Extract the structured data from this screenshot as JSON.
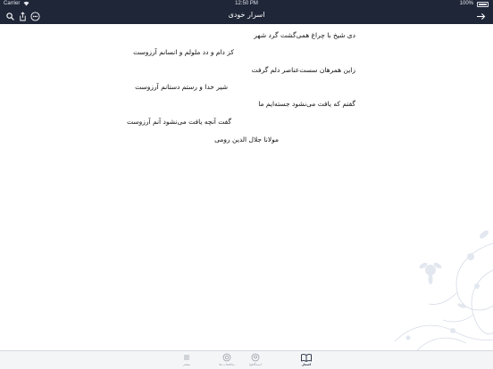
{
  "status_bar": {
    "carrier": "Carrier",
    "time": "12:50 PM",
    "battery": "100%"
  },
  "nav": {
    "title": "اسرار خودی",
    "left_icons": [
      "search-icon",
      "share-icon",
      "settings-icon"
    ],
    "right_icon": "forward-arrow-icon"
  },
  "poem": {
    "lines": [
      "دی شیخ با چراغ همی‌گشت گرد شهر",
      "کز دام و دد ملولم و انسانم آرزوست",
      "زاین همرهان سست‌عناصر دلم گرفت",
      "شیر خدا و رستم دستانم آرزوست",
      "گفتم که یافت می‌نشود جسته‌ایم ما",
      "گفت آنچه یافت می‌نشود آنم آرزوست"
    ],
    "author": "مولانا جلال الدین رومی"
  },
  "tabs": [
    {
      "label": "اشعار",
      "icon": "book-icon",
      "active": true
    },
    {
      "label": "ایستگاهها",
      "icon": "location-icon",
      "active": false
    },
    {
      "label": "مناقشات ها",
      "icon": "circle-icon",
      "active": false
    },
    {
      "label": "بیشتر",
      "icon": "more-icon",
      "active": false
    }
  ],
  "colors": {
    "header": "#1f2638",
    "text": "#111111",
    "tab_bar": "#f4f5f7",
    "tab_inactive": "#9aa0aa"
  }
}
